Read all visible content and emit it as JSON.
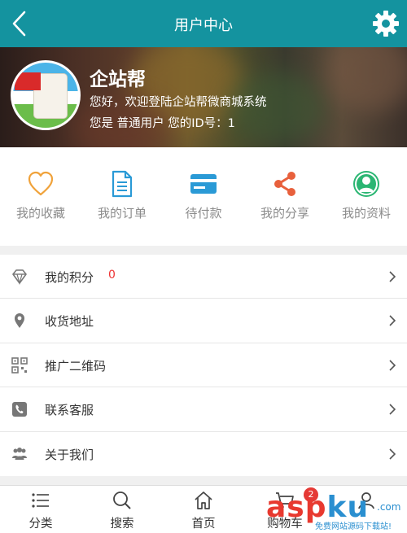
{
  "header": {
    "title": "用户中心",
    "back_icon": "chevron-left-icon",
    "settings_icon": "gear-icon",
    "bar_color": "#14939f"
  },
  "profile": {
    "name": "企站帮",
    "welcome": "您好，欢迎登陆企站帮微商城系统",
    "info": "您是 普通用户 您的ID号：1"
  },
  "shortcuts": [
    {
      "label": "我的收藏",
      "icon": "heart-icon",
      "color": "#f0a23a"
    },
    {
      "label": "我的订单",
      "icon": "document-icon",
      "color": "#2a9ad6"
    },
    {
      "label": "待付款",
      "icon": "card-icon",
      "color": "#2a9ad6"
    },
    {
      "label": "我的分享",
      "icon": "share-icon",
      "color": "#e8603c"
    },
    {
      "label": "我的资料",
      "icon": "user-icon",
      "color": "#2bb673"
    }
  ],
  "menu": [
    {
      "label": "我的积分",
      "icon": "diamond-icon",
      "count": "0"
    },
    {
      "label": "收货地址",
      "icon": "location-icon"
    },
    {
      "label": "推广二维码",
      "icon": "qrcode-icon"
    },
    {
      "label": "联系客服",
      "icon": "phone-icon"
    },
    {
      "label": "关于我们",
      "icon": "group-icon"
    }
  ],
  "tabbar": [
    {
      "label": "分类",
      "icon": "list-icon"
    },
    {
      "label": "搜索",
      "icon": "search-icon"
    },
    {
      "label": "首页",
      "icon": "home-icon"
    },
    {
      "label": "购物车",
      "icon": "cart-icon",
      "badge": "2"
    },
    {
      "label": "",
      "icon": "user-icon"
    }
  ],
  "watermark": {
    "main": "asp",
    "main_k": "ku",
    "small": ".com",
    "sub": "免费网站源码下载站!"
  }
}
